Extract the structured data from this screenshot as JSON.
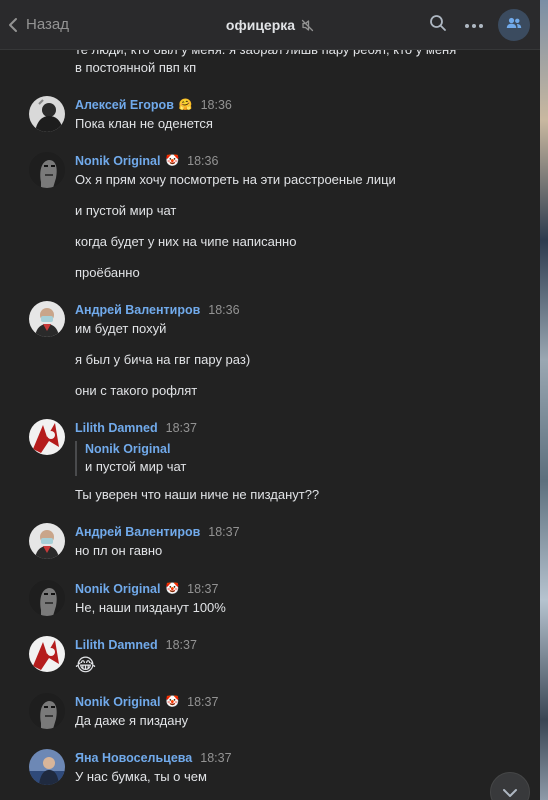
{
  "header": {
    "back_label": "Назад",
    "title": "офицерка",
    "title_muted_icon": "mute-icon",
    "search_icon": "search-icon",
    "more_icon": "more-icon",
    "members_icon": "members-icon"
  },
  "colors": {
    "background": "#222222",
    "header": "#2a2a2c",
    "author": "#71aaeb",
    "time": "#939393",
    "text": "#e1e3e6"
  },
  "top_partial": {
    "line1": "те люди, кто был у меня. я забрал лишь пару ребят, кто у меня",
    "line2": "в постоянной пвп кп"
  },
  "messages": [
    {
      "author": "Алексей Егоров",
      "badge": "🤗",
      "time": "18:36",
      "lines": [
        "Пока клан не оденется"
      ]
    },
    {
      "author": "Nonik Original",
      "badge": "🤡",
      "time": "18:36",
      "lines": [
        "Ох я прям хочу посмотреть на эти расстроеные лици",
        "и пустой мир чат",
        "когда будет у них на чипе написанно",
        "проёбанно"
      ]
    },
    {
      "author": "Андрей Валентиров",
      "badge": "",
      "time": "18:36",
      "lines": [
        "им будет похуй",
        "я был у бича на гвг пару раз)",
        "они с такого рофлят"
      ]
    },
    {
      "author": "Lilith Damned",
      "badge": "",
      "time": "18:37",
      "reply": {
        "author": "Nonik Original",
        "text": "и пустой мир чат"
      },
      "lines": [
        "Ты уверен что наши ниче не пизданут??"
      ]
    },
    {
      "author": "Андрей Валентиров",
      "badge": "",
      "time": "18:37",
      "lines": [
        "но пл он гавно"
      ]
    },
    {
      "author": "Nonik Original",
      "badge": "🤡",
      "time": "18:37",
      "lines": [
        "Не, наши пизданут 100%"
      ]
    },
    {
      "author": "Lilith Damned",
      "badge": "",
      "time": "18:37",
      "lines": [
        "😂"
      ]
    },
    {
      "author": "Nonik Original",
      "badge": "🤡",
      "time": "18:37",
      "lines": [
        "Да даже я пиздану"
      ]
    },
    {
      "author": "Яна Новосельцева",
      "badge": "",
      "time": "18:37",
      "lines": [
        "У нас бумка, ты о чем"
      ]
    }
  ],
  "scroll_down_icon": "chevron-down-icon"
}
